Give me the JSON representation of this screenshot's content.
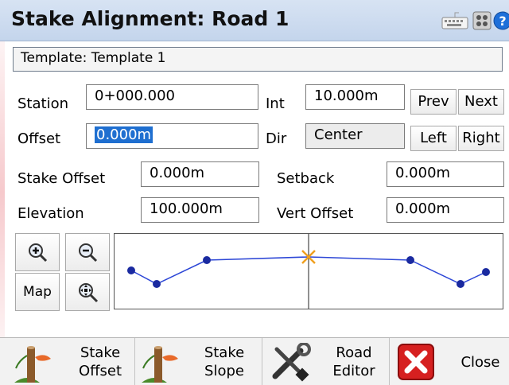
{
  "window": {
    "title": "Stake Alignment: Road 1"
  },
  "title_icons": [
    "keyboard-icon",
    "grid-icon",
    "help-icon"
  ],
  "template": {
    "text": "Template: Template 1"
  },
  "station": {
    "label": "Station",
    "value": "0+000.000"
  },
  "interval": {
    "label": "Int",
    "value": "10.000m"
  },
  "offset": {
    "label": "Offset",
    "value": "0.000m"
  },
  "direction": {
    "label": "Dir",
    "value": "Center"
  },
  "stake_offset": {
    "label": "Stake Offset",
    "value": "0.000m"
  },
  "setback": {
    "label": "Setback",
    "value": "0.000m"
  },
  "elevation": {
    "label": "Elevation",
    "value": "100.000m"
  },
  "vert_offset": {
    "label": "Vert Offset",
    "value": "0.000m"
  },
  "buttons": {
    "prev": "Prev",
    "next": "Next",
    "left": "Left",
    "right": "Right",
    "map": "Map"
  },
  "bottom": {
    "stake_offset": [
      "Stake",
      "Offset"
    ],
    "stake_slope": [
      "Stake",
      "Slope"
    ],
    "road_editor": [
      "Road",
      "Editor"
    ],
    "close": "Close"
  },
  "colors": {
    "title_bg": "#c9d8ee",
    "point": "#1a2aa0",
    "line": "#2c46d6",
    "marker": "#f0a020",
    "close_red": "#d62020"
  }
}
